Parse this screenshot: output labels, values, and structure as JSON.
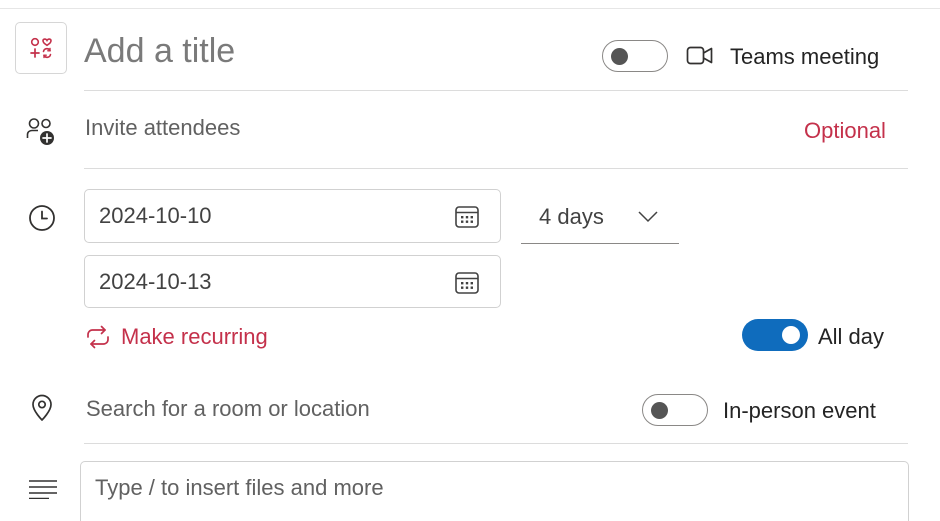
{
  "title": {
    "placeholder": "Add a title"
  },
  "teams_meeting": {
    "label": "Teams meeting",
    "enabled": false
  },
  "attendees": {
    "placeholder": "Invite attendees",
    "optional_label": "Optional"
  },
  "schedule": {
    "start_date": "2024-10-10",
    "end_date": "2024-10-13",
    "duration": "4 days",
    "recurring_label": "Make recurring",
    "all_day_label": "All day",
    "all_day": true
  },
  "location": {
    "placeholder": "Search for a room or location",
    "in_person_label": "In-person event",
    "in_person": false
  },
  "body": {
    "placeholder": "Type / to insert files and more"
  },
  "colors": {
    "accent": "#0f6cbd",
    "optional_red": "#c4314b"
  }
}
